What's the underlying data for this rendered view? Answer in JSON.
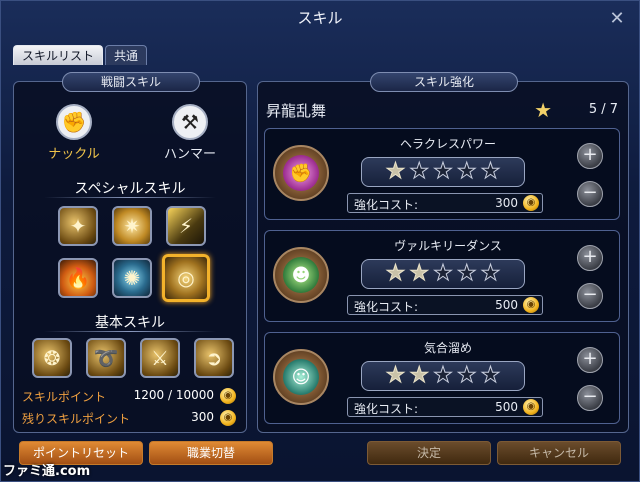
{
  "window": {
    "title": "スキル",
    "close_glyph": "✕"
  },
  "tabs": [
    {
      "label": "スキルリスト"
    },
    {
      "label": "共通"
    }
  ],
  "left": {
    "section_title": "戦闘スキル",
    "weapons": [
      {
        "label": "ナックル",
        "icon": "fist-icon",
        "glyph": "✊"
      },
      {
        "label": "ハンマー",
        "icon": "hammer-icon",
        "glyph": "⚒"
      }
    ],
    "special_title": "スペシャルスキル",
    "special_glyphs": [
      "✦",
      "✷",
      "⚡",
      "🔥",
      "✺",
      "◎"
    ],
    "basic_title": "基本スキル",
    "basic_glyphs": [
      "❂",
      "➰",
      "⚔",
      "➲"
    ],
    "skill_points": {
      "label": "スキルポイント",
      "value": "1200 / 10000"
    },
    "remaining_points": {
      "label": "残りスキルポイント",
      "value": "300"
    },
    "coin_glyph": "◉"
  },
  "right": {
    "section_title": "スキル強化",
    "skill_name": "昇龍乱舞",
    "star_glyph": "★",
    "count": "5 / 7",
    "cost_label": "強化コスト:",
    "plus_glyph": "+",
    "minus_glyph": "−",
    "enhancements": [
      {
        "name": "ヘラクレスパワー",
        "stars_filled": 1,
        "stars_total": 5,
        "cost": "300",
        "emblem_glyph": "✊"
      },
      {
        "name": "ヴァルキリーダンス",
        "stars_filled": 2,
        "stars_total": 5,
        "cost": "500",
        "emblem_glyph": "☻"
      },
      {
        "name": "気合溜め",
        "stars_filled": 2,
        "stars_total": 5,
        "cost": "500",
        "emblem_glyph": "☺"
      }
    ]
  },
  "buttons": {
    "reset": "ポイントリセット",
    "job_switch": "職業切替",
    "confirm": "決定",
    "cancel": "キャンセル"
  },
  "watermark": "ファミ通.com"
}
